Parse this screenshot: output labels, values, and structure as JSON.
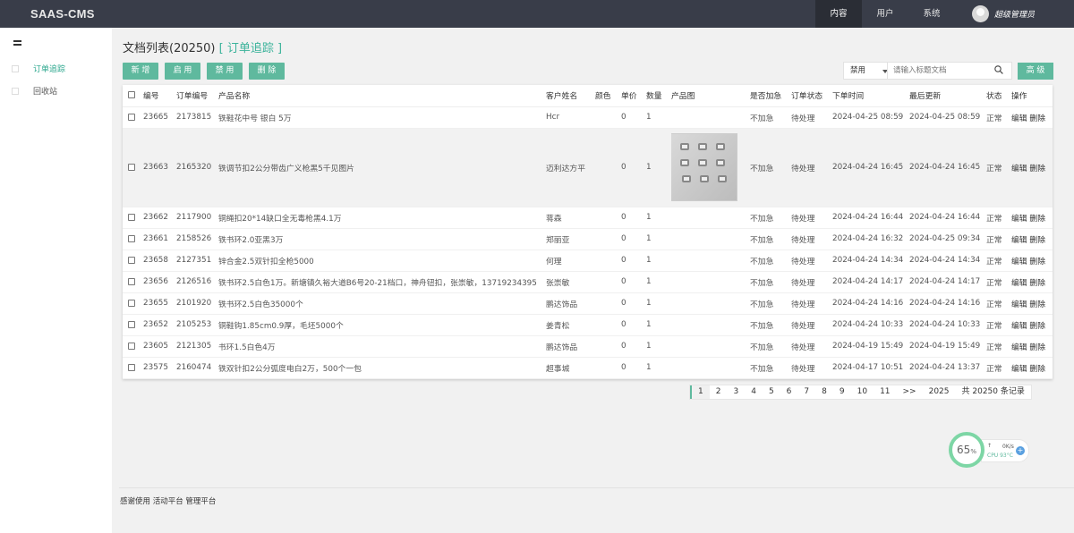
{
  "app": {
    "logo": "SAAS-CMS"
  },
  "topnav": [
    {
      "label": "内容",
      "active": true
    },
    {
      "label": "用户",
      "active": false
    },
    {
      "label": "系统",
      "active": false
    }
  ],
  "user": {
    "name": "超级管理员"
  },
  "sidebar": {
    "items": [
      {
        "label": "订单追踪",
        "active": true
      },
      {
        "label": "回收站",
        "active": false
      }
    ]
  },
  "page": {
    "title": "文档列表(20250)",
    "bracket_open": "[",
    "bracket_link": "订单追踪",
    "bracket_close": "]"
  },
  "toolbar": {
    "buttons": [
      "新 增",
      "启 用",
      "禁 用",
      "删 除"
    ],
    "status_select": "禁用",
    "search_placeholder": "请输入标题文档",
    "advanced": "高 级"
  },
  "table": {
    "headers": [
      "编号",
      "订单编号",
      "产品名称",
      "客户姓名",
      "颜色",
      "单价",
      "数量",
      "产品图",
      "是否加急",
      "订单状态",
      "下单时间",
      "最后更新",
      "状态",
      "操作"
    ],
    "rows": [
      {
        "id": "23665",
        "order": "2173815",
        "product": "铁鞋花中号 银白 5万",
        "customer": "Hcr",
        "color": "",
        "price": "0",
        "qty": "1",
        "urgent": "不加急",
        "status": "待处理",
        "created": "2024-04-25 08:59",
        "updated": "2024-04-25 08:59",
        "state": "正常",
        "edit": "编辑",
        "del": "删除"
      },
      {
        "id": "23663",
        "order": "2165320",
        "product": "铁调节扣2公分带齿广义枪黑5千见图片",
        "customer": "迈利达方平",
        "color": "",
        "price": "0",
        "qty": "1",
        "urgent": "不加急",
        "status": "待处理",
        "created": "2024-04-24 16:45",
        "updated": "2024-04-24 16:45",
        "state": "正常",
        "edit": "编辑",
        "del": "删除",
        "image": true
      },
      {
        "id": "23662",
        "order": "2117900",
        "product": "铜绳扣20*14缺口全无毒枪黑4.1万",
        "customer": "蒋森",
        "color": "",
        "price": "0",
        "qty": "1",
        "urgent": "不加急",
        "status": "待处理",
        "created": "2024-04-24 16:44",
        "updated": "2024-04-24 16:44",
        "state": "正常",
        "edit": "编辑",
        "del": "删除"
      },
      {
        "id": "23661",
        "order": "2158526",
        "product": "铁书环2.0亚黑3万",
        "customer": "郑丽亚",
        "color": "",
        "price": "0",
        "qty": "1",
        "urgent": "不加急",
        "status": "待处理",
        "created": "2024-04-24 16:32",
        "updated": "2024-04-25 09:34",
        "state": "正常",
        "edit": "编辑",
        "del": "删除"
      },
      {
        "id": "23658",
        "order": "2127351",
        "product": "锌合金2.5双针扣全枪5000",
        "customer": "何理",
        "color": "",
        "price": "0",
        "qty": "1",
        "urgent": "不加急",
        "status": "待处理",
        "created": "2024-04-24 14:34",
        "updated": "2024-04-24 14:34",
        "state": "正常",
        "edit": "编辑",
        "del": "删除"
      },
      {
        "id": "23656",
        "order": "2126516",
        "product": "铁书环2.5白色1万。新塘镇久裕大道B6号20-21档口，神舟钮扣，张崇敏，13719234395",
        "customer": "张崇敏",
        "color": "",
        "price": "0",
        "qty": "1",
        "urgent": "不加急",
        "status": "待处理",
        "created": "2024-04-24 14:17",
        "updated": "2024-04-24 14:17",
        "state": "正常",
        "edit": "编辑",
        "del": "删除"
      },
      {
        "id": "23655",
        "order": "2101920",
        "product": "铁书环2.5白色35000个",
        "customer": "鹏达饰品",
        "color": "",
        "price": "0",
        "qty": "1",
        "urgent": "不加急",
        "status": "待处理",
        "created": "2024-04-24 14:16",
        "updated": "2024-04-24 14:16",
        "state": "正常",
        "edit": "编辑",
        "del": "删除"
      },
      {
        "id": "23652",
        "order": "2105253",
        "product": "铜鞋钩1.85cm0.9厚，毛坯5000个",
        "customer": "姜青松",
        "color": "",
        "price": "0",
        "qty": "1",
        "urgent": "不加急",
        "status": "待处理",
        "created": "2024-04-24 10:33",
        "updated": "2024-04-24 10:33",
        "state": "正常",
        "edit": "编辑",
        "del": "删除"
      },
      {
        "id": "23605",
        "order": "2121305",
        "product": "书环1.5白色4万",
        "customer": "鹏达饰品",
        "color": "",
        "price": "0",
        "qty": "1",
        "urgent": "不加急",
        "status": "待处理",
        "created": "2024-04-19 15:49",
        "updated": "2024-04-19 15:49",
        "state": "正常",
        "edit": "编辑",
        "del": "删除"
      },
      {
        "id": "23575",
        "order": "2160474",
        "product": "铁双针扣2公分弧度电白2万，500个一包",
        "customer": "超事城",
        "color": "",
        "price": "0",
        "qty": "1",
        "urgent": "不加急",
        "status": "待处理",
        "created": "2024-04-17 10:51",
        "updated": "2024-04-24 13:37",
        "state": "正常",
        "edit": "编辑",
        "del": "删除"
      }
    ]
  },
  "pagination": {
    "pages": [
      "1",
      "2",
      "3",
      "4",
      "5",
      "6",
      "7",
      "8",
      "9",
      "10",
      "11",
      ">>",
      "2025"
    ],
    "current": "1",
    "total": "共 20250 条记录"
  },
  "footer": {
    "text": "感谢使用 活动平台 管理平台"
  },
  "cpu_widget": {
    "percent": "65",
    "unit": "%",
    "speed": "0K/s",
    "label": "CPU 93°C",
    "arrow": "↑"
  },
  "colors": {
    "accent": "#5fb99e",
    "topbar": "#393d49",
    "link": "#3cb39b"
  }
}
